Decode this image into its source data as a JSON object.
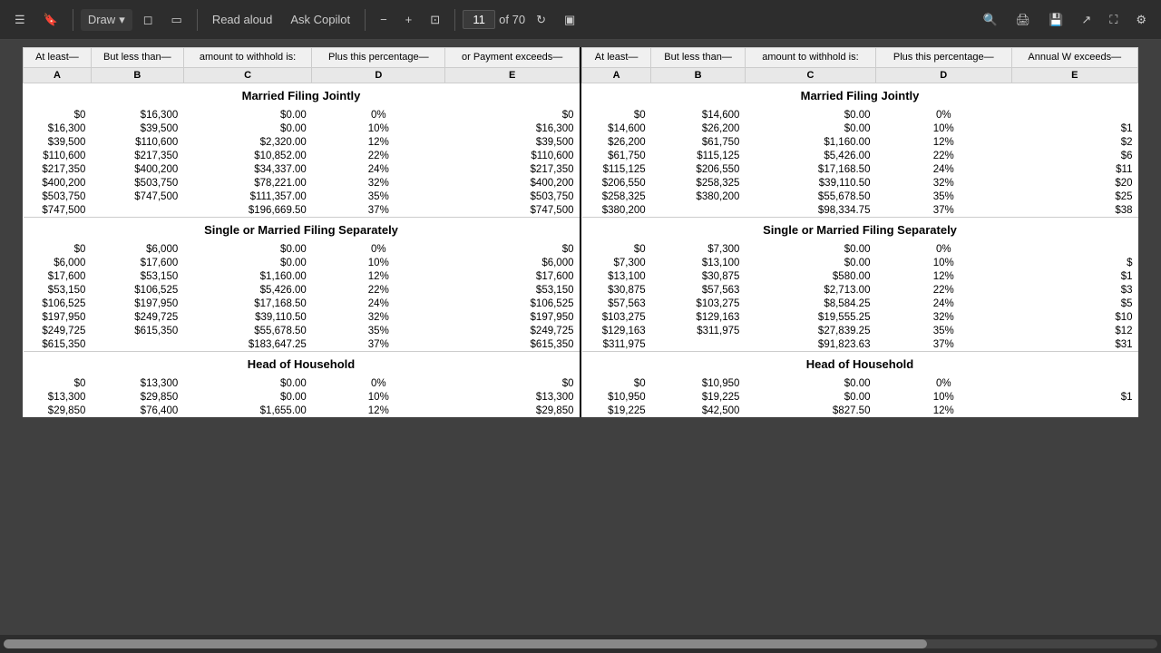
{
  "toolbar": {
    "menu_icon": "☰",
    "bookmark_icon": "🔖",
    "draw_label": "Draw",
    "eraser_icon": "◻",
    "highlight_icon": "▭",
    "read_aloud_label": "Read aloud",
    "ask_copilot_label": "Ask Copilot",
    "zoom_out_icon": "−",
    "zoom_in_icon": "+",
    "fit_icon": "⊡",
    "page_current": "11",
    "page_of": "of 70",
    "rotate_icon": "↻",
    "view_icon": "▣",
    "search_icon": "🔍",
    "print_icon": "🖨",
    "save_icon": "💾",
    "share_icon": "↗",
    "fullscreen_icon": "⛶",
    "settings_icon": "⚙"
  },
  "columns": {
    "left": {
      "headers": [
        "At least—",
        "But less than—",
        "amount to withhold is:",
        "Plus this percentage—",
        "or Payment exceeds—"
      ],
      "letters": [
        "A",
        "B",
        "C",
        "D",
        "E"
      ]
    },
    "right": {
      "headers": [
        "At least—",
        "But less than—",
        "amount to withhold is:",
        "Plus this percentage—",
        "Annual W exceeds—"
      ],
      "letters": [
        "A",
        "B",
        "C",
        "D",
        "E"
      ]
    }
  },
  "left_table": {
    "married_filing_jointly": {
      "title": "Married Filing Jointly",
      "rows": [
        [
          "$0",
          "$16,300",
          "$0.00",
          "0%",
          "$0"
        ],
        [
          "$16,300",
          "$39,500",
          "$0.00",
          "10%",
          "$16,300"
        ],
        [
          "$39,500",
          "$110,600",
          "$2,320.00",
          "12%",
          "$39,500"
        ],
        [
          "$110,600",
          "$217,350",
          "$10,852.00",
          "22%",
          "$110,600"
        ],
        [
          "$217,350",
          "$400,200",
          "$34,337.00",
          "24%",
          "$217,350"
        ],
        [
          "$400,200",
          "$503,750",
          "$78,221.00",
          "32%",
          "$400,200"
        ],
        [
          "$503,750",
          "$747,500",
          "$111,357.00",
          "35%",
          "$503,750"
        ],
        [
          "$747,500",
          "",
          "$196,669.50",
          "37%",
          "$747,500"
        ]
      ]
    },
    "single": {
      "title": "Single or Married Filing Separately",
      "rows": [
        [
          "$0",
          "$6,000",
          "$0.00",
          "0%",
          "$0"
        ],
        [
          "$6,000",
          "$17,600",
          "$0.00",
          "10%",
          "$6,000"
        ],
        [
          "$17,600",
          "$53,150",
          "$1,160.00",
          "12%",
          "$17,600"
        ],
        [
          "$53,150",
          "$106,525",
          "$5,426.00",
          "22%",
          "$53,150"
        ],
        [
          "$106,525",
          "$197,950",
          "$17,168.50",
          "24%",
          "$106,525"
        ],
        [
          "$197,950",
          "$249,725",
          "$39,110.50",
          "32%",
          "$197,950"
        ],
        [
          "$249,725",
          "$615,350",
          "$55,678.50",
          "35%",
          "$249,725"
        ],
        [
          "$615,350",
          "",
          "$183,647.25",
          "37%",
          "$615,350"
        ]
      ]
    },
    "head_of_household": {
      "title": "Head of Household",
      "rows": [
        [
          "$0",
          "$13,300",
          "$0.00",
          "0%",
          "$0"
        ],
        [
          "$13,300",
          "$29,850",
          "$0.00",
          "10%",
          "$13,300"
        ],
        [
          "$29,850",
          "$76,400",
          "$1,655.00",
          "12%",
          "$29,850"
        ]
      ]
    }
  },
  "right_table": {
    "married_filing_jointly": {
      "title": "Married Filing Jointly",
      "rows": [
        [
          "$0",
          "$14,600",
          "$0.00",
          "0%",
          ""
        ],
        [
          "$14,600",
          "$26,200",
          "$0.00",
          "10%",
          "$1"
        ],
        [
          "$26,200",
          "$61,750",
          "$1,160.00",
          "12%",
          "$2"
        ],
        [
          "$61,750",
          "$115,125",
          "$5,426.00",
          "22%",
          "$6"
        ],
        [
          "$115,125",
          "$206,550",
          "$17,168.50",
          "24%",
          "$11"
        ],
        [
          "$206,550",
          "$258,325",
          "$39,110.50",
          "32%",
          "$20"
        ],
        [
          "$258,325",
          "$380,200",
          "$55,678.50",
          "35%",
          "$25"
        ],
        [
          "$380,200",
          "",
          "$98,334.75",
          "37%",
          "$38"
        ]
      ]
    },
    "single": {
      "title": "Single or Married Filing Separately",
      "rows": [
        [
          "$0",
          "$7,300",
          "$0.00",
          "0%",
          ""
        ],
        [
          "$7,300",
          "$13,100",
          "$0.00",
          "10%",
          "$"
        ],
        [
          "$13,100",
          "$30,875",
          "$580.00",
          "12%",
          "$1"
        ],
        [
          "$30,875",
          "$57,563",
          "$2,713.00",
          "22%",
          "$3"
        ],
        [
          "$57,563",
          "$103,275",
          "$8,584.25",
          "24%",
          "$5"
        ],
        [
          "$103,275",
          "$129,163",
          "$19,555.25",
          "32%",
          "$10"
        ],
        [
          "$129,163",
          "$311,975",
          "$27,839.25",
          "35%",
          "$12"
        ],
        [
          "$311,975",
          "",
          "$91,823.63",
          "37%",
          "$31"
        ]
      ]
    },
    "head_of_household": {
      "title": "Head of Household",
      "rows": [
        [
          "$0",
          "$10,950",
          "$0.00",
          "0%",
          ""
        ],
        [
          "$10,950",
          "$19,225",
          "$0.00",
          "10%",
          "$1"
        ],
        [
          "$19,225",
          "$42,500",
          "$827.50",
          "12%",
          ""
        ]
      ]
    }
  }
}
